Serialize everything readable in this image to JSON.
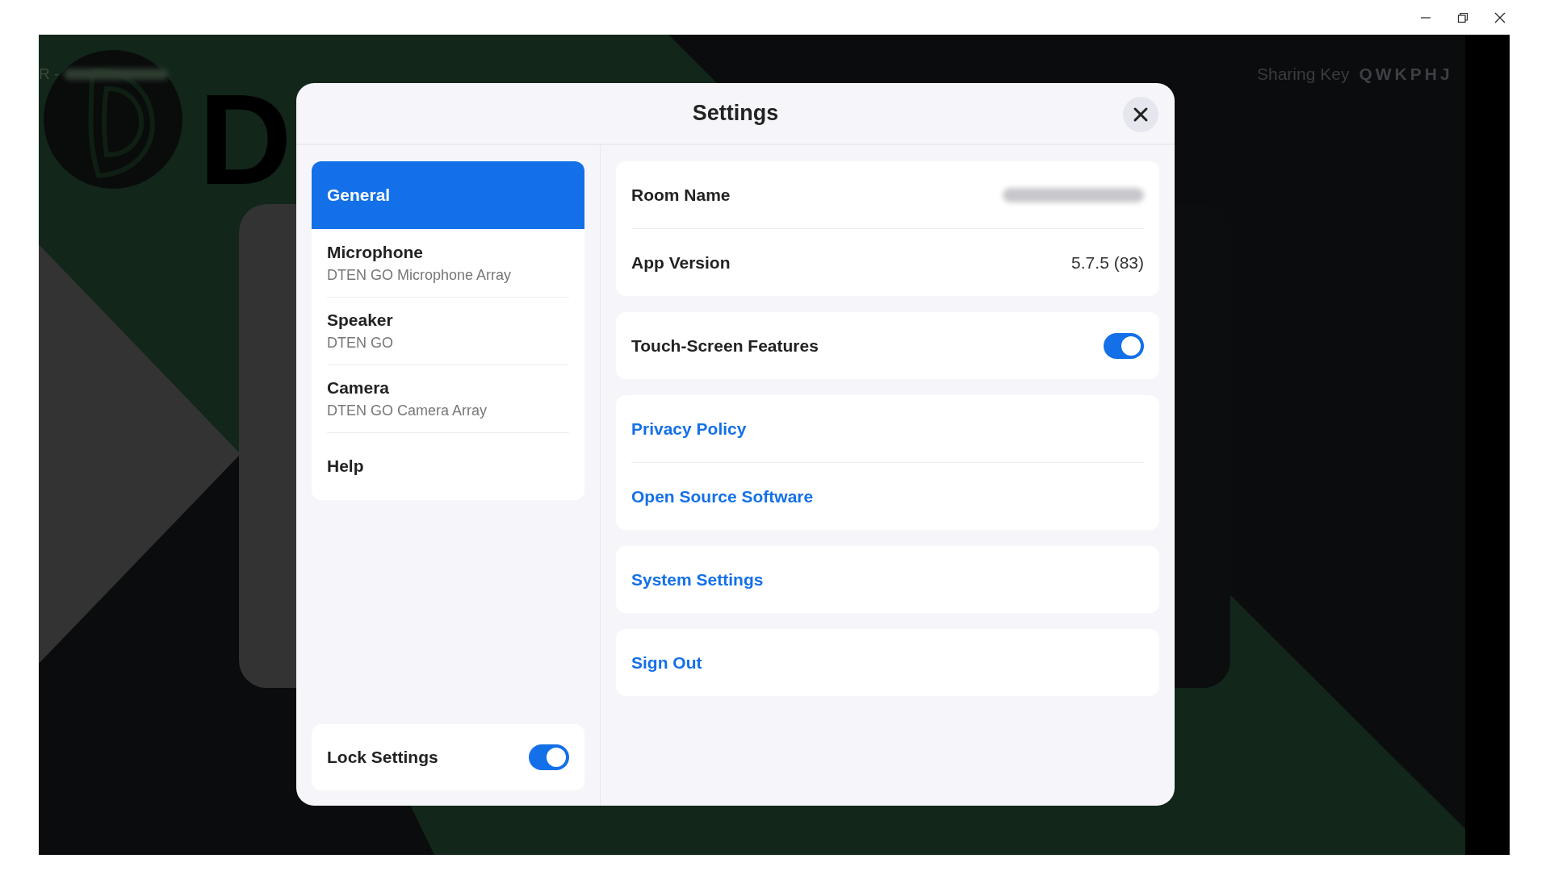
{
  "background": {
    "caption_prefix": "R -",
    "logo_text": "D",
    "sharing_key_label": "Sharing Key",
    "sharing_key": "QWKPHJ"
  },
  "dialog": {
    "title": "Settings",
    "sidebar": {
      "items": [
        {
          "label": "General",
          "selected": true
        },
        {
          "label": "Microphone",
          "detail": "DTEN GO Microphone Array",
          "selected": false
        },
        {
          "label": "Speaker",
          "detail": "DTEN GO",
          "selected": false
        },
        {
          "label": "Camera",
          "detail": "DTEN GO Camera Array",
          "selected": false
        },
        {
          "label": "Help",
          "selected": false
        }
      ],
      "lock": {
        "label": "Lock Settings",
        "on": true
      }
    },
    "groups": [
      [
        {
          "kind": "info",
          "label": "Room Name",
          "redacted": true
        },
        {
          "kind": "info",
          "label": "App Version",
          "value": "5.7.5 (83)"
        }
      ],
      [
        {
          "kind": "toggle",
          "label": "Touch-Screen Features",
          "on": true
        }
      ],
      [
        {
          "kind": "link",
          "label": "Privacy Policy"
        },
        {
          "kind": "link",
          "label": "Open Source Software"
        }
      ],
      [
        {
          "kind": "link",
          "label": "System Settings"
        }
      ],
      [
        {
          "kind": "link",
          "label": "Sign Out"
        }
      ]
    ]
  }
}
